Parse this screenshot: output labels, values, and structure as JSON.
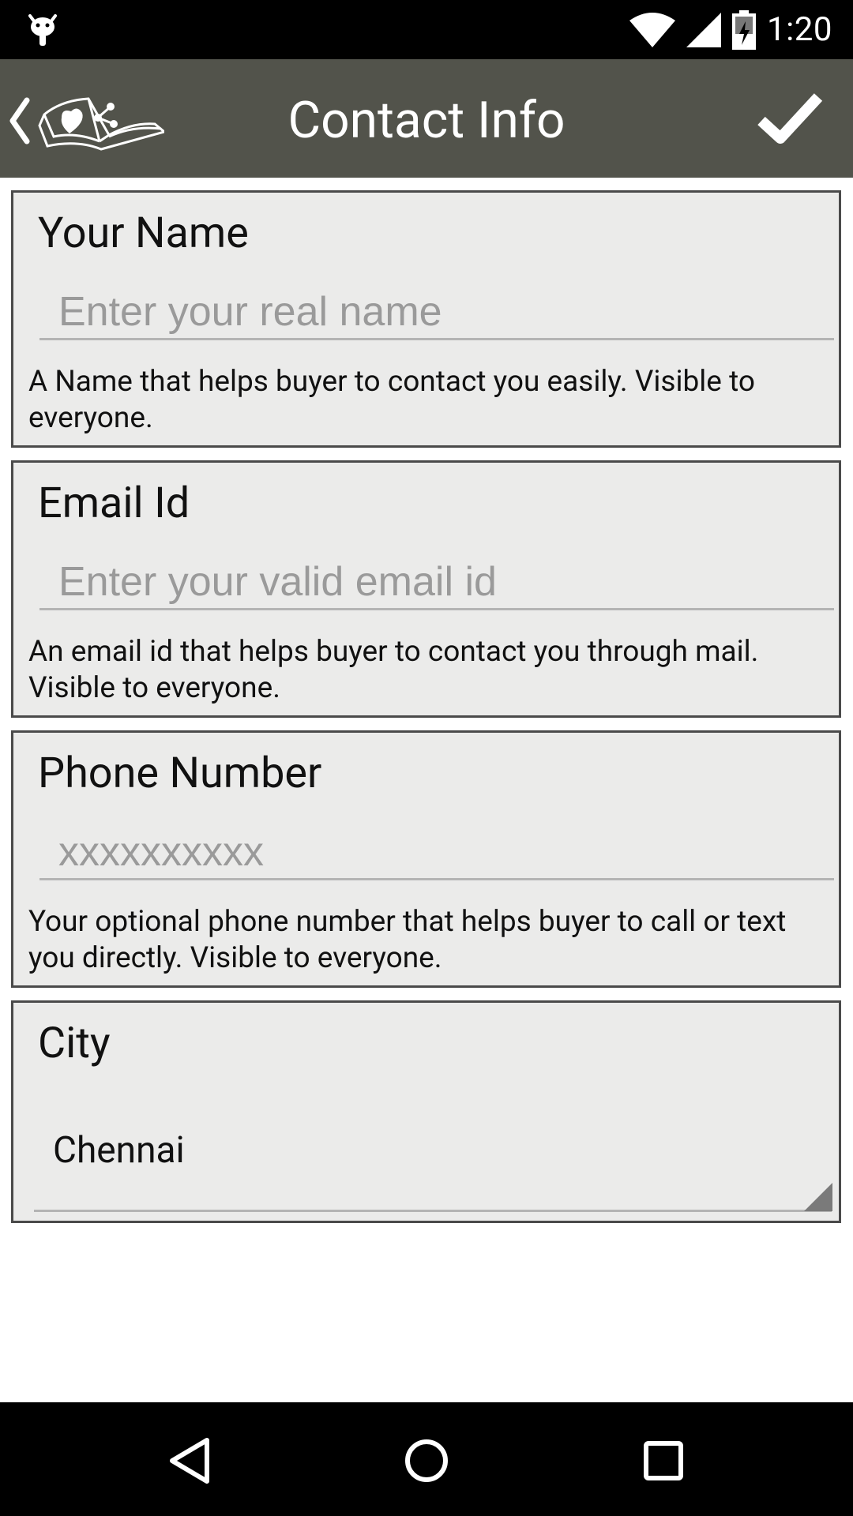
{
  "status_bar": {
    "time": "1:20",
    "icons": [
      "android-debug-icon",
      "wifi-icon",
      "signal-icon",
      "battery-charging-icon"
    ]
  },
  "app_bar": {
    "title": "Contact Info",
    "back_icon": "chevron-left-icon",
    "logo": "book-heart-share-logo",
    "done_icon": "checkmark-icon"
  },
  "form": {
    "name": {
      "label": "Your Name",
      "placeholder": "Enter your real name",
      "value": "",
      "help": "A Name that helps buyer to contact you easily. Visible to everyone."
    },
    "email": {
      "label": "Email Id",
      "placeholder": "Enter your valid email id",
      "value": "",
      "help": "An email id that helps buyer to contact you through mail. Visible to everyone."
    },
    "phone": {
      "label": "Phone Number",
      "placeholder": "xxxxxxxxxx",
      "value": "",
      "help": "Your optional phone number that helps buyer to call or text you directly. Visible to everyone."
    },
    "city": {
      "label": "City",
      "selected": "Chennai"
    }
  },
  "nav_bar": {
    "icons": [
      "back-triangle-icon",
      "home-circle-icon",
      "recents-square-icon"
    ]
  },
  "colors": {
    "app_bar": "#52534b",
    "card_bg": "#ebebea",
    "card_border": "#4a4a4a",
    "status_bar": "#000000"
  }
}
